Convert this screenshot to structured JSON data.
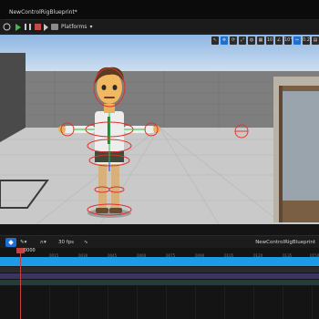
{
  "tab": {
    "title": "NewControlRigBlueprint*"
  },
  "toolbar": {
    "platforms_label": "Platforms"
  },
  "viewport": {
    "tools": [
      "↖",
      "✥",
      "⟳",
      "⤢",
      "◍",
      "▦",
      "10",
      "∠",
      "10°",
      "⇔",
      "0.25",
      "▤"
    ]
  },
  "sequencer": {
    "fps_label": "30 fps",
    "asset_title": "NewControlRigBlueprint",
    "current_frame": "0000",
    "ticks": [
      "0015",
      "0030",
      "0045",
      "0060",
      "0075",
      "0090",
      "0105",
      "0120",
      "0135",
      "0150"
    ]
  },
  "colors": {
    "accent": "#1f6fd0",
    "section": "#1e9be6",
    "play": "#4bb34a",
    "stop": "#c24a4a",
    "playhead": "#c84040"
  }
}
